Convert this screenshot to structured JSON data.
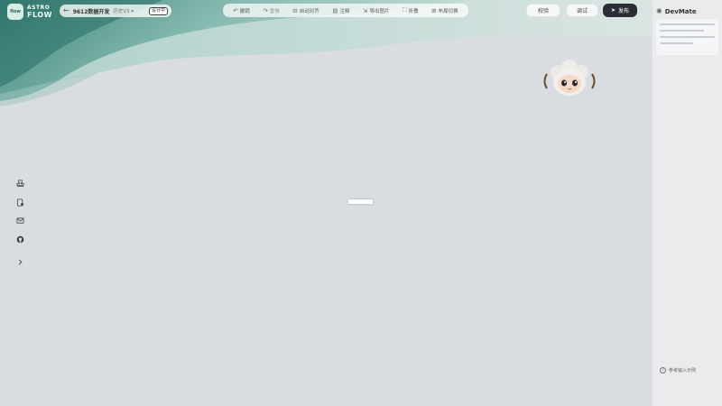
{
  "app": {
    "logo_badge": "flow",
    "logo_line1": "ASTRO",
    "logo_line2": "FLOW"
  },
  "project": {
    "name": "9612数据开发",
    "version": "历史V3",
    "status": "设计中"
  },
  "toolbar": {
    "items": [
      {
        "label": "撤销",
        "icon": "undo-icon"
      },
      {
        "label": "重做",
        "icon": "redo-icon"
      },
      {
        "label": "自动对齐",
        "icon": "align-icon"
      },
      {
        "label": "注释",
        "icon": "comment-icon"
      },
      {
        "label": "导出图片",
        "icon": "export-icon"
      },
      {
        "label": "折叠",
        "icon": "collapse-icon"
      },
      {
        "label": "布局切换",
        "icon": "layout-icon"
      }
    ]
  },
  "actions": {
    "check_label": "校验",
    "debug_label": "调试",
    "publish_label": "发布"
  },
  "assistant": {
    "title": "DevMate",
    "hint": "参考输入示例"
  },
  "colors": {
    "accent_dark": "#2b2f35",
    "wave_teal": "#3f8c80",
    "background": "#d9dde1"
  }
}
